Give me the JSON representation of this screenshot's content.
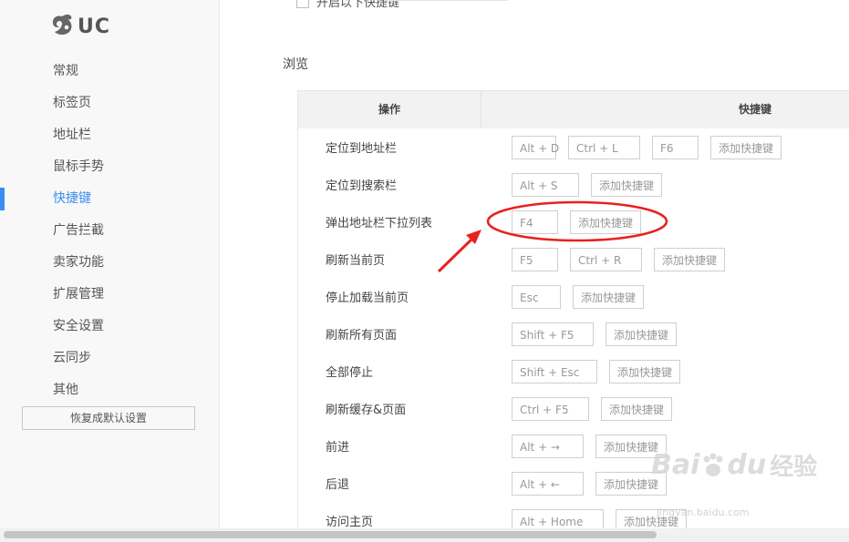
{
  "app": {
    "logo_text": "UC"
  },
  "sidebar": {
    "items": [
      {
        "label": "常规"
      },
      {
        "label": "标签页"
      },
      {
        "label": "地址栏"
      },
      {
        "label": "鼠标手势"
      },
      {
        "label": "快捷键",
        "active": true
      },
      {
        "label": "广告拦截"
      },
      {
        "label": "卖家功能"
      },
      {
        "label": "扩展管理"
      },
      {
        "label": "安全设置"
      },
      {
        "label": "云同步"
      },
      {
        "label": "其他"
      }
    ],
    "reset_label": "恢复成默认设置"
  },
  "main": {
    "top_checkbox_label": "开启以下快捷键",
    "section_title": "浏览",
    "table": {
      "headers": {
        "operation": "操作",
        "shortcut": "快捷键"
      },
      "rows": [
        {
          "op": "定位到地址栏",
          "keys": [
            "Alt + D",
            "Ctrl + L",
            "F6"
          ],
          "add": "添加快捷键"
        },
        {
          "op": "定位到搜索栏",
          "keys": [
            "Alt + S"
          ],
          "add": "添加快捷键"
        },
        {
          "op": "弹出地址栏下拉列表",
          "keys": [
            "F4"
          ],
          "add": "添加快捷键"
        },
        {
          "op": "刷新当前页",
          "keys": [
            "F5",
            "Ctrl + R"
          ],
          "add": "添加快捷键"
        },
        {
          "op": "停止加载当前页",
          "keys": [
            "Esc"
          ],
          "add": "添加快捷键"
        },
        {
          "op": "刷新所有页面",
          "keys": [
            "Shift + F5"
          ],
          "add": "添加快捷键"
        },
        {
          "op": "全部停止",
          "keys": [
            "Shift + Esc"
          ],
          "add": "添加快捷键"
        },
        {
          "op": "刷新缓存&页面",
          "keys": [
            "Ctrl + F5"
          ],
          "add": "添加快捷键"
        },
        {
          "op": "前进",
          "keys": [
            "Alt + →"
          ],
          "add": "添加快捷键"
        },
        {
          "op": "后退",
          "keys": [
            "Alt + ←"
          ],
          "add": "添加快捷键"
        },
        {
          "op": "访问主页",
          "keys": [
            "Alt + Home"
          ],
          "add": "添加快捷键"
        }
      ]
    }
  },
  "watermark": {
    "brand": "Bai",
    "brand2": "du",
    "cn": "经验",
    "url": "jingyan.baidu.com"
  },
  "colors": {
    "accent": "#3a8ef0",
    "annotation": "#e8211c"
  }
}
